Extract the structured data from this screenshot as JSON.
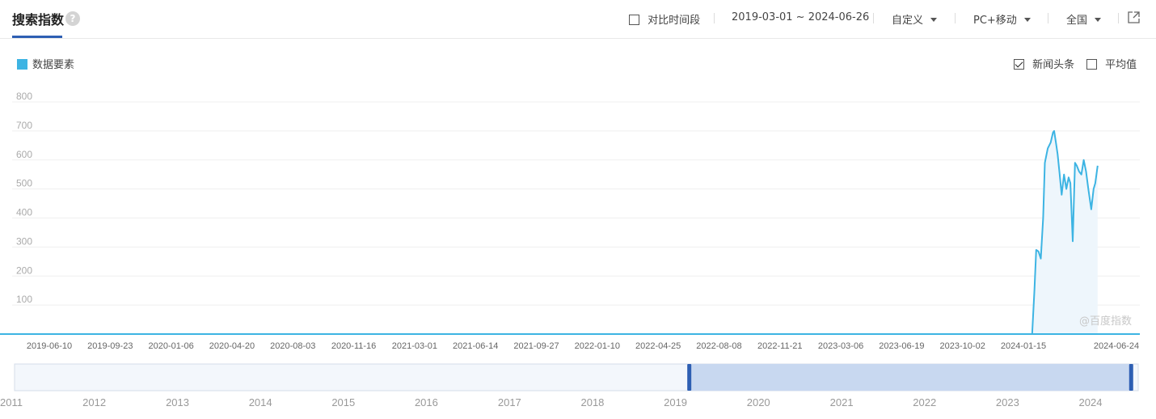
{
  "header": {
    "title": "搜索指数",
    "help_glyph": "?",
    "compare_label": "对比时间段",
    "date_range": "2019-03-01 ~ 2024-06-26",
    "custom_label": "自定义",
    "device_label": "PC+移动",
    "region_label": "全国"
  },
  "legend": {
    "series_label": "数据要素"
  },
  "options": {
    "news_label": "新闻头条",
    "news_checked": true,
    "avg_label": "平均值",
    "avg_checked": false
  },
  "watermark": "@百度指数",
  "colors": {
    "line": "#3db4e3",
    "accent": "#2e5fb3",
    "fill": "#eef6fc",
    "nav_selected": "#c8d8f0"
  },
  "chart_data": {
    "type": "area",
    "title": "",
    "xlabel": "",
    "ylabel": "",
    "ylim": [
      0,
      800
    ],
    "yticks": [
      100,
      200,
      300,
      400,
      500,
      600,
      700,
      800
    ],
    "x_start": "2019-03-01",
    "x_end": "2024-06-26",
    "xticks": [
      "2019-06-10",
      "2019-09-23",
      "2020-01-06",
      "2020-04-20",
      "2020-08-03",
      "2020-11-16",
      "2021-03-01",
      "2021-06-14",
      "2021-09-27",
      "2022-01-10",
      "2022-04-25",
      "2022-08-08",
      "2022-11-21",
      "2023-03-06",
      "2023-06-19",
      "2023-10-02",
      "2024-01-15",
      "2024-06-24"
    ],
    "series": [
      {
        "name": "数据要素",
        "points": [
          [
            "2019-03-01",
            0
          ],
          [
            "2024-01-30",
            0
          ],
          [
            "2024-02-03",
            150
          ],
          [
            "2024-02-06",
            290
          ],
          [
            "2024-02-10",
            285
          ],
          [
            "2024-02-14",
            260
          ],
          [
            "2024-02-18",
            400
          ],
          [
            "2024-02-21",
            590
          ],
          [
            "2024-02-26",
            640
          ],
          [
            "2024-03-02",
            660
          ],
          [
            "2024-03-06",
            695
          ],
          [
            "2024-03-08",
            700
          ],
          [
            "2024-03-11",
            660
          ],
          [
            "2024-03-14",
            620
          ],
          [
            "2024-03-17",
            560
          ],
          [
            "2024-03-21",
            480
          ],
          [
            "2024-03-25",
            550
          ],
          [
            "2024-03-29",
            500
          ],
          [
            "2024-04-02",
            540
          ],
          [
            "2024-04-05",
            520
          ],
          [
            "2024-04-09",
            320
          ],
          [
            "2024-04-13",
            590
          ],
          [
            "2024-04-16",
            580
          ],
          [
            "2024-04-20",
            560
          ],
          [
            "2024-04-24",
            550
          ],
          [
            "2024-04-28",
            600
          ],
          [
            "2024-05-02",
            560
          ],
          [
            "2024-05-06",
            500
          ],
          [
            "2024-05-11",
            430
          ],
          [
            "2024-05-15",
            500
          ],
          [
            "2024-05-18",
            520
          ],
          [
            "2024-05-22",
            580
          ]
        ]
      }
    ]
  },
  "navigator": {
    "year_labels": [
      "2011",
      "2012",
      "2013",
      "2014",
      "2015",
      "2016",
      "2017",
      "2018",
      "2019",
      "2020",
      "2021",
      "2022",
      "2023",
      "2024"
    ],
    "range_start": "2019-03-01",
    "range_end": "2024-06-26"
  }
}
